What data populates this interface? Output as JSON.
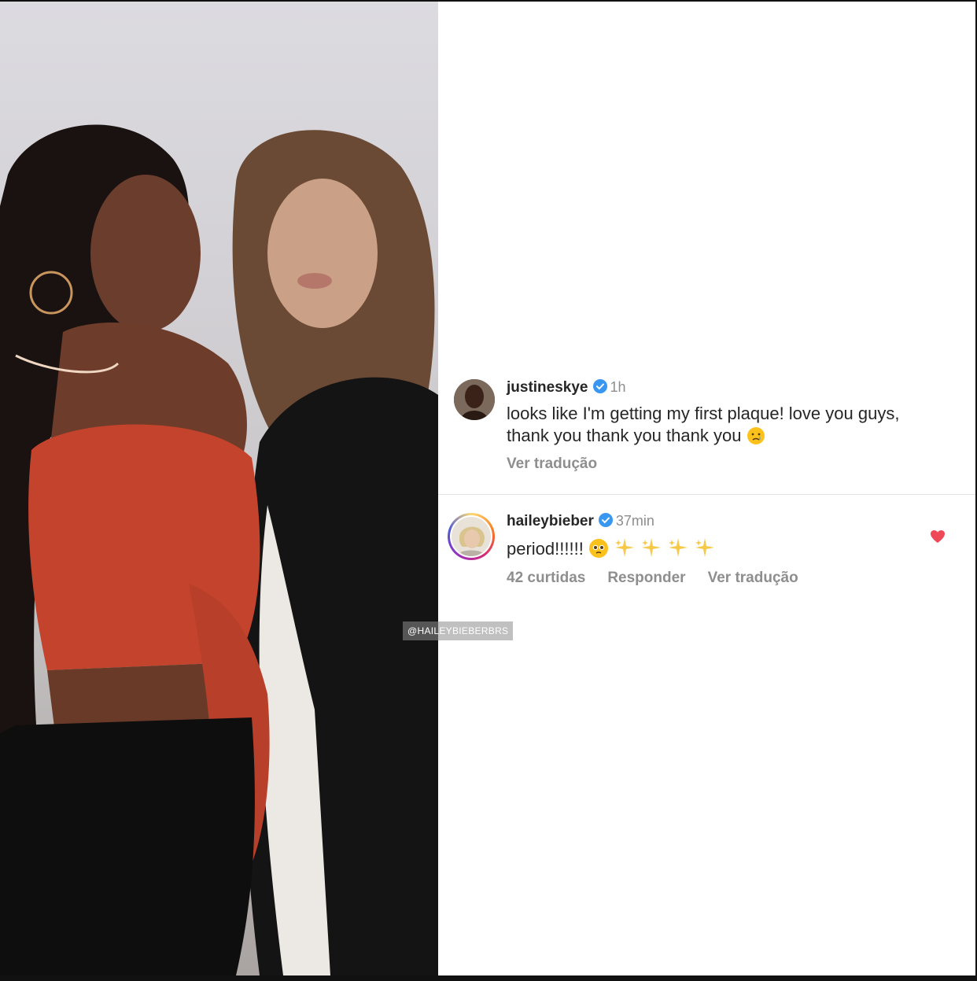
{
  "watermark": "@HAILEYBIEBERBRS",
  "comments": [
    {
      "username": "justineskye",
      "time": "1h",
      "text_line1": "looks like I'm getting my first plaque! love you guys,",
      "text_line2": "thank you thank you thank you",
      "emoji": "crying-face",
      "translate": "Ver tradução"
    },
    {
      "username": "haileybieber",
      "time": "37min",
      "text": "period!!!!!!",
      "emojis": [
        "pleading-face",
        "sparkles",
        "sparkles",
        "sparkles",
        "sparkles"
      ],
      "likes": "42 curtidas",
      "reply": "Responder",
      "translate": "Ver tradução",
      "liked": true
    }
  ],
  "colors": {
    "verified": "#3897f0",
    "heart": "#ed4956",
    "muted": "#8e8e8e"
  }
}
